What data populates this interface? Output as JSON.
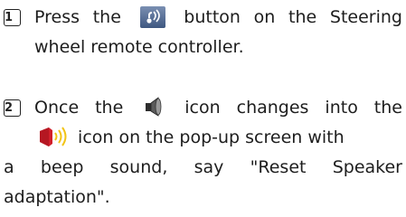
{
  "step1": {
    "marker": "1",
    "line1a": "Press the",
    "line1b": "button on the Steering",
    "line2": "wheel remote controller.",
    "icon": "voice-recognition-button-icon"
  },
  "step2": {
    "marker": "2",
    "line1a": "Once the",
    "line1b": "icon changes into the",
    "line2": "icon on the pop-up screen with",
    "line3": "a beep sound, say \"Reset Speaker",
    "line4": "adaptation\".",
    "icon_a": "speaker-icon",
    "icon_b": "red-speaker-sound-icon"
  },
  "colors": {
    "button_blue": "#4a6591",
    "icon_red": "#d21f2b",
    "icon_yellow": "#f2c417"
  }
}
